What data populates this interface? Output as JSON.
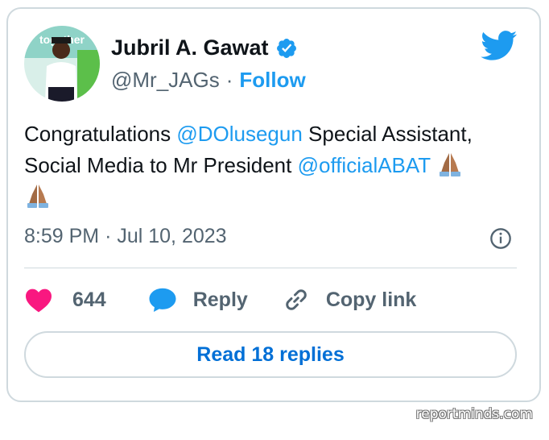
{
  "author": {
    "name": "Jubril A. Gawat",
    "handle": "@Mr_JAGs",
    "separator": "·",
    "follow_label": "Follow",
    "avatar_banner_text": "together"
  },
  "tweet": {
    "text_1": "Congratulations ",
    "mention_1": "@DOlusegun",
    "text_2": " Special Assistant, Social Media to Mr President ",
    "mention_2": "@officialABAT",
    "emoji": "folded-hands"
  },
  "meta": {
    "time": "8:59 PM",
    "separator": "·",
    "date": "Jul 10, 2023"
  },
  "actions": {
    "like_count": "644",
    "reply_label": "Reply",
    "copy_link_label": "Copy link"
  },
  "read_replies_label": "Read 18 replies",
  "watermark": "reportminds.com",
  "colors": {
    "twitter_blue": "#1d9bf0",
    "like_pink": "#f91880",
    "text_secondary": "#536471",
    "border": "#cfd9de"
  }
}
